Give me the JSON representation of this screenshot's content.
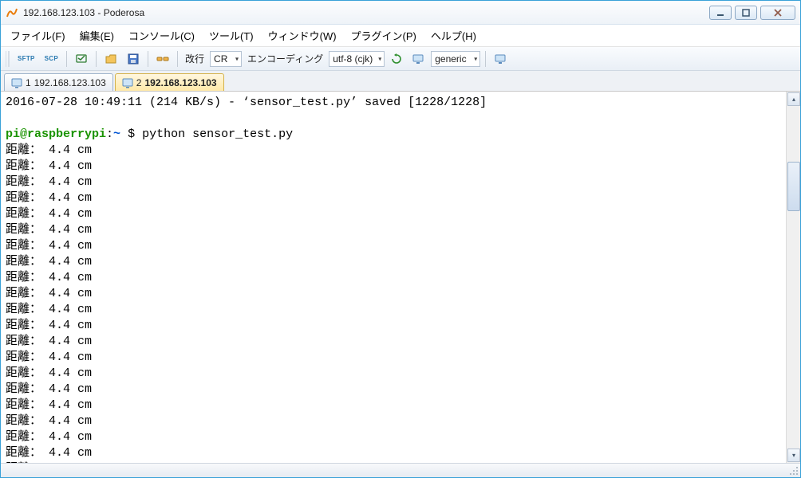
{
  "window": {
    "title": "192.168.123.103 - Poderosa"
  },
  "menu": {
    "file": "ファイル(F)",
    "edit": "編集(E)",
    "console": "コンソール(C)",
    "tool": "ツール(T)",
    "window": "ウィンドウ(W)",
    "plugin": "プラグイン(P)",
    "help": "ヘルプ(H)"
  },
  "toolbar": {
    "sftp": "SFTP",
    "scp": "SCP",
    "newline_label": "改行",
    "newline_value": "CR",
    "encoding_label": "エンコーディング",
    "encoding_value": "utf-8 (cjk)",
    "render_value": "generic"
  },
  "tabs": [
    {
      "index": "1",
      "label": "192.168.123.103",
      "active": false
    },
    {
      "index": "2",
      "label": "192.168.123.103",
      "active": true
    }
  ],
  "terminal": {
    "header_line": "2016-07-28 10:49:11 (214 KB/s) - ‘sensor_test.py’ saved [1228/1228]",
    "prompt_userhost": "pi@raspberrypi",
    "prompt_colon": ":",
    "prompt_path": "~",
    "prompt_sym": " $ ",
    "command": "python sensor_test.py",
    "distance_label": "距離：",
    "distance_value": "4.4 cm",
    "distance_count": 20,
    "partial_line": "距離    "
  }
}
